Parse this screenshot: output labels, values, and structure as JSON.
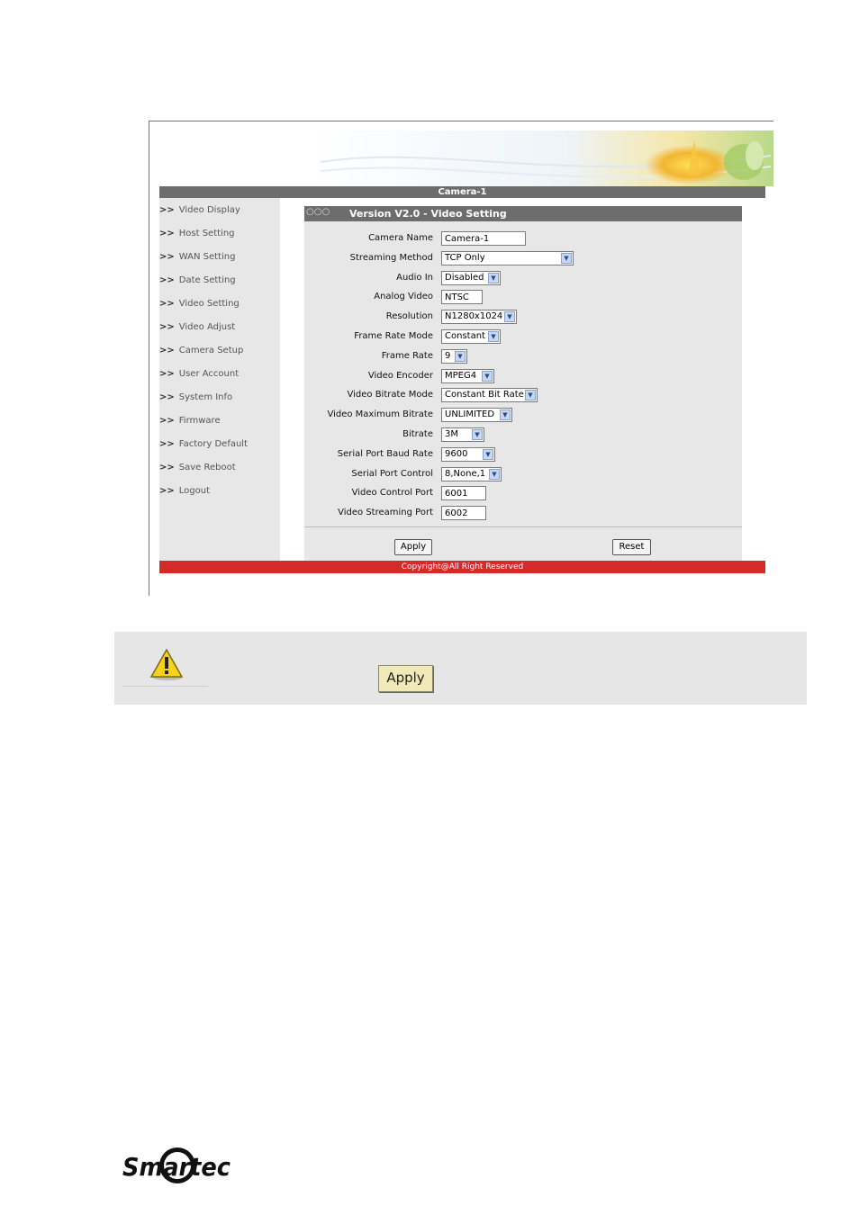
{
  "window": {
    "camera_title": "Camera-1",
    "copyright": "Copyright@All Right Reserved"
  },
  "sidebar": {
    "arrow": ">>",
    "items": [
      {
        "label": "Video Display"
      },
      {
        "label": "Host Setting"
      },
      {
        "label": "WAN Setting"
      },
      {
        "label": "Date Setting"
      },
      {
        "label": "Video Setting"
      },
      {
        "label": "Video Adjust"
      },
      {
        "label": "Camera Setup"
      },
      {
        "label": "User Account"
      },
      {
        "label": "System Info"
      },
      {
        "label": "Firmware"
      },
      {
        "label": "Factory Default"
      },
      {
        "label": "Save Reboot"
      },
      {
        "label": "Logout"
      }
    ]
  },
  "main": {
    "title": "Version V2.0 - Video Setting",
    "fields": [
      {
        "label": "Camera Name",
        "value": "Camera-1",
        "kind": "text"
      },
      {
        "label": "Streaming Method",
        "value": "TCP Only",
        "kind": "select"
      },
      {
        "label": "Audio In",
        "value": "Disabled",
        "kind": "select"
      },
      {
        "label": "Analog Video",
        "value": "NTSC",
        "kind": "text"
      },
      {
        "label": "Resolution",
        "value": "N1280x1024",
        "kind": "select"
      },
      {
        "label": "Frame Rate Mode",
        "value": "Constant",
        "kind": "select"
      },
      {
        "label": "Frame Rate",
        "value": "9",
        "kind": "select"
      },
      {
        "label": "Video Encoder",
        "value": "MPEG4",
        "kind": "select"
      },
      {
        "label": "Video Bitrate Mode",
        "value": "Constant Bit Rate",
        "kind": "select"
      },
      {
        "label": "Video Maximum Bitrate",
        "value": "UNLIMITED",
        "kind": "select"
      },
      {
        "label": "Bitrate",
        "value": "3M",
        "kind": "select"
      },
      {
        "label": "Serial Port Baud Rate",
        "value": "9600",
        "kind": "select"
      },
      {
        "label": "Serial Port Control",
        "value": "8,None,1",
        "kind": "select"
      },
      {
        "label": "Video Control Port",
        "value": "6001",
        "kind": "text"
      },
      {
        "label": "Video Streaming Port",
        "value": "6002",
        "kind": "text"
      }
    ],
    "apply_label": "Apply",
    "reset_label": "Reset"
  },
  "note": {
    "icon": "warning-icon",
    "apply_label": "Apply"
  },
  "logo": {
    "text": "Smartec"
  },
  "colors": {
    "header_gray": "#6d6d6d",
    "panel_gray": "#e7e7e7",
    "footer_red": "#d52a2a",
    "note_bg": "#e6e6e6",
    "apply_yellow": "#f1e9b7"
  }
}
